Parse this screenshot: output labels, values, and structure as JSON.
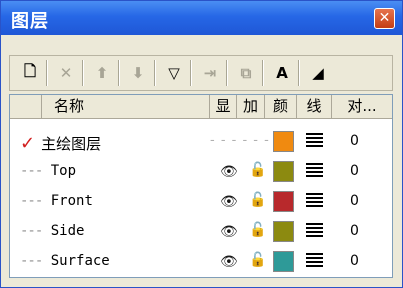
{
  "window": {
    "title": "图层",
    "close_icon": "✕"
  },
  "toolbar": {
    "buttons": [
      {
        "name": "new-layer-icon",
        "glyph": "🗋",
        "disabled": false
      },
      {
        "name": "delete-icon",
        "glyph": "✕",
        "disabled": true
      },
      {
        "name": "move-up-icon",
        "glyph": "⬆",
        "disabled": true
      },
      {
        "name": "move-down-icon",
        "glyph": "⬇",
        "disabled": true
      },
      {
        "name": "filter-icon",
        "glyph": "▽",
        "disabled": false
      },
      {
        "name": "import-icon",
        "glyph": "⇥",
        "disabled": true
      },
      {
        "name": "copy-layer-icon",
        "glyph": "⧉",
        "disabled": true
      },
      {
        "name": "text-icon",
        "glyph": "A",
        "disabled": false
      },
      {
        "name": "triangle-icon",
        "glyph": "◢",
        "disabled": false
      }
    ]
  },
  "columns": [
    "名称",
    "显",
    "加",
    "颜",
    "线",
    "对..."
  ],
  "layers": [
    {
      "name": "主绘图层",
      "current": true,
      "visible_marker": "- - - - - -",
      "color": "#f08a10",
      "value": "0"
    },
    {
      "name": "Top",
      "current": false,
      "color": "#8c8a10",
      "value": "0"
    },
    {
      "name": "Front",
      "current": false,
      "color": "#b8292c",
      "value": "0"
    },
    {
      "name": "Side",
      "current": false,
      "color": "#8c8a10",
      "value": "0"
    },
    {
      "name": "Surface",
      "current": false,
      "color": "#2e9a98",
      "value": "0"
    }
  ],
  "icons": {
    "check": "✓",
    "eye": "👁",
    "lock": "🔓",
    "dash": "---"
  }
}
